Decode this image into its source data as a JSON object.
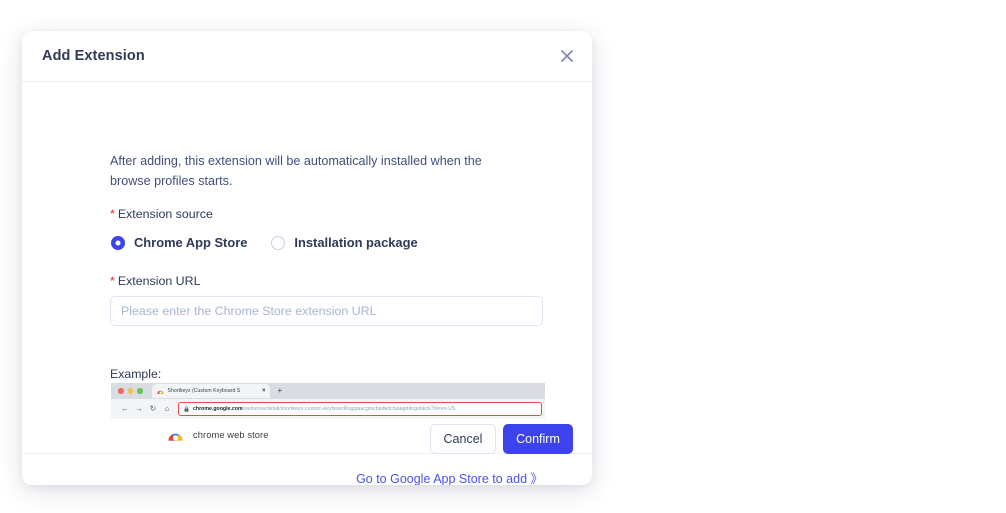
{
  "dialog": {
    "title": "Add Extension",
    "close_icon": "close-icon",
    "description": "After adding, this extension will be automatically installed when the browse profiles starts.",
    "required_marker": "*",
    "source_field": {
      "label": "Extension source",
      "options": [
        {
          "label": "Chrome App Store",
          "selected": true
        },
        {
          "label": "Installation package",
          "selected": false
        }
      ]
    },
    "url_field": {
      "label": "Extension URL",
      "value": "",
      "placeholder": "Please enter the Chrome Store extension URL"
    },
    "example": {
      "label": "Example:",
      "browser": {
        "tab_title": "Shortkeys (Custom Keyboard S",
        "tab_close_label": "×",
        "new_tab_label": "+",
        "nav_back": "←",
        "nav_forward": "→",
        "nav_reload": "↻",
        "nav_home": "⌂",
        "url_host": "chrome.google.com",
        "url_path": "/webstore/detail/shortkeys-custom-keyboard/logpjaacgmcbpdkdchjaagddngobkck?hl=en-US",
        "result_text": "chrome web store"
      }
    },
    "store_link": "Go to Google App Store to add 》",
    "footer": {
      "cancel_label": "Cancel",
      "confirm_label": "Confirm"
    }
  },
  "colors": {
    "accent": "#3d43ec",
    "link": "#4a53f0",
    "required": "#f5222d",
    "title_text": "#2e3a59",
    "body_text": "#41507a",
    "placeholder": "#a9b4d4",
    "border": "#dfe4f2",
    "highlight_box": "#e74c3c"
  }
}
